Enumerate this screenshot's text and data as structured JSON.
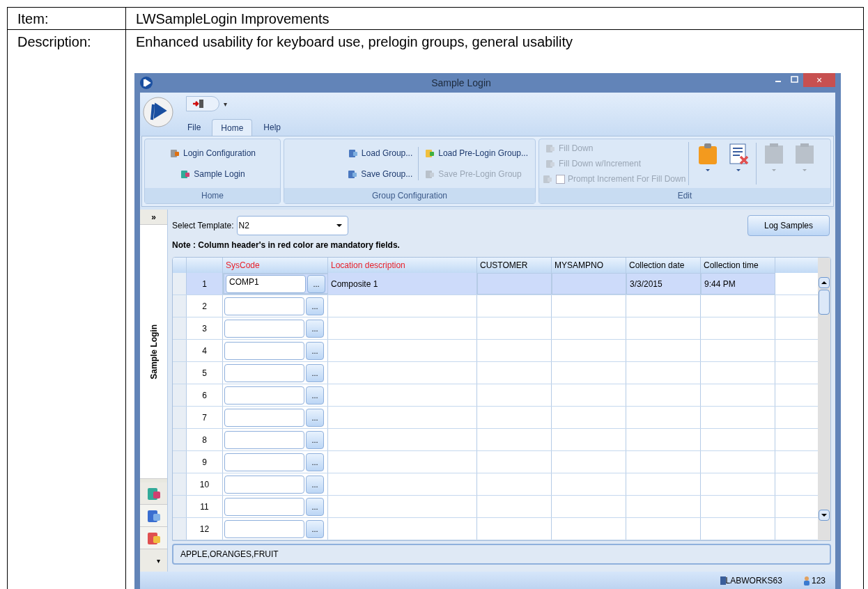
{
  "document": {
    "item_label": "Item:",
    "item_value": "LWSampleLogin Improvements",
    "description_label": "Description:",
    "description_value": "Enhanced usability for keyboard use, prelogin groups, general usability"
  },
  "window": {
    "title": "Sample Login",
    "quick_access_more": "▾",
    "close": "×"
  },
  "tabs": [
    {
      "label": "File",
      "selected": false
    },
    {
      "label": "Home",
      "selected": true
    },
    {
      "label": "Help",
      "selected": false
    }
  ],
  "ribbon": {
    "home": {
      "label": "Home",
      "items": [
        {
          "label": "Login Configuration",
          "disabled": false
        },
        {
          "label": "Sample Login",
          "disabled": false
        }
      ]
    },
    "group_configuration": {
      "label": "Group Configuration",
      "items": [
        {
          "label": "Load Group...",
          "disabled": false
        },
        {
          "label": "Save Group...",
          "disabled": false
        },
        {
          "label": "Load Pre-Login Group...",
          "disabled": false
        },
        {
          "label": "Save Pre-Login Group",
          "disabled": true
        }
      ]
    },
    "edit": {
      "label": "Edit",
      "items": [
        {
          "kind": "button",
          "label": "Fill Down",
          "disabled": true
        },
        {
          "kind": "button",
          "label": "Fill Down w/Increment",
          "disabled": true
        },
        {
          "kind": "checkbox",
          "label": "Prompt Increment For Fill Down",
          "disabled": true,
          "checked": false
        }
      ],
      "big_buttons": [
        {
          "disabled": false
        },
        {
          "disabled": false
        },
        {
          "disabled": true
        },
        {
          "disabled": true
        }
      ]
    }
  },
  "side_panel": {
    "expand": "»",
    "title": "Sample Login",
    "menu": "▾"
  },
  "template": {
    "label": "Select Template:",
    "value": "N2"
  },
  "note": "Note : Column header's in red color are mandatory fields.",
  "log_button": "Log Samples",
  "table": {
    "columns": [
      {
        "label": "SysCode",
        "mandatory": true
      },
      {
        "label": "Location description",
        "mandatory": true
      },
      {
        "label": "CUSTOMER",
        "mandatory": false
      },
      {
        "label": "MYSAMPNO",
        "mandatory": false
      },
      {
        "label": "Collection date",
        "mandatory": false
      },
      {
        "label": "Collection time",
        "mandatory": false
      }
    ],
    "rows": [
      {
        "number": "1",
        "selected": true,
        "browse": "...",
        "syscode": "COMP1",
        "location": "Composite 1",
        "collection_date": "3/3/2015",
        "collection_time": "9:44 PM"
      },
      {
        "number": "2",
        "selected": false,
        "browse": "..."
      },
      {
        "number": "3",
        "selected": false,
        "browse": "..."
      },
      {
        "number": "4",
        "selected": false,
        "browse": "..."
      },
      {
        "number": "5",
        "selected": false,
        "browse": "..."
      },
      {
        "number": "6",
        "selected": false,
        "browse": "..."
      },
      {
        "number": "7",
        "selected": false,
        "browse": "..."
      },
      {
        "number": "8",
        "selected": false,
        "browse": "..."
      },
      {
        "number": "9",
        "selected": false,
        "browse": "..."
      },
      {
        "number": "10",
        "selected": false,
        "browse": "..."
      },
      {
        "number": "11",
        "selected": false,
        "browse": "..."
      },
      {
        "number": "12",
        "selected": false,
        "browse": "..."
      }
    ]
  },
  "footer_text": "APPLE,ORANGES,FRUIT",
  "status_bar": {
    "database": "LABWORKS63",
    "user": "123"
  }
}
